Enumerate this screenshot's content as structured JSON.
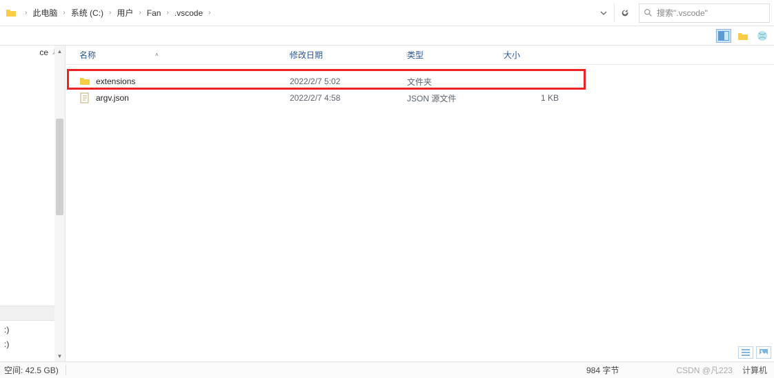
{
  "breadcrumb": {
    "items": [
      "此电脑",
      "系统 (C:)",
      "用户",
      "Fan",
      ".vscode"
    ]
  },
  "search": {
    "placeholder": "搜索\".vscode\""
  },
  "columns": {
    "name": "名称",
    "date": "修改日期",
    "type": "类型",
    "size": "大小"
  },
  "rows": [
    {
      "name": "extensions",
      "date": "2022/2/7 5:02",
      "type": "文件夹",
      "size": "",
      "icon": "folder"
    },
    {
      "name": "argv.json",
      "date": "2022/2/7 4:58",
      "type": "JSON 源文件",
      "size": "1 KB",
      "icon": "json"
    }
  ],
  "left": {
    "item0": "ce",
    "drive1": ":)",
    "drive2": ":)"
  },
  "status": {
    "left": "空间: 42.5 GB)",
    "mid": "984 字节",
    "r1": "CSDN @凡223",
    "r2": "计算机"
  }
}
